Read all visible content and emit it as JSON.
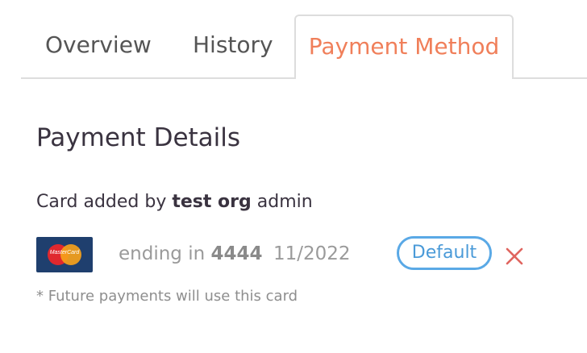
{
  "tabs": {
    "overview": "Overview",
    "history": "History",
    "payment_method": "Payment Method",
    "active": "payment_method"
  },
  "payment": {
    "title": "Payment Details",
    "added_prefix": "Card added by ",
    "added_by": "test org",
    "added_suffix": " admin",
    "card": {
      "brand_text": "MasterCard",
      "ending_prefix": "ending in ",
      "last4": "4444",
      "expiry": "11/2022",
      "badge": "Default"
    },
    "footnote": "* Future payments will use this card"
  },
  "colors": {
    "accent": "#f07f5a",
    "badge_blue": "#5aa9e6",
    "remove_red": "#e0655f"
  },
  "icons": {
    "card": "mastercard-logo-icon",
    "remove": "close-icon"
  }
}
